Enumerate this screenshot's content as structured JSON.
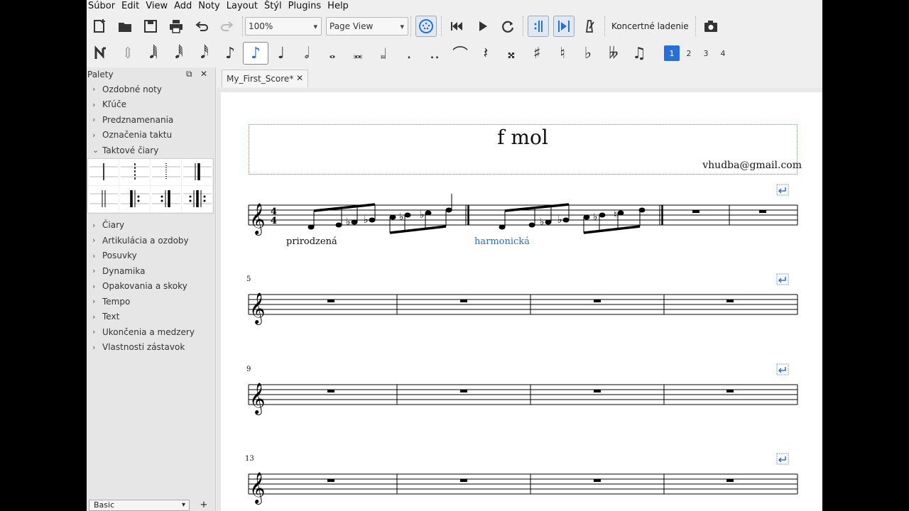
{
  "menu": [
    "Súbor",
    "Edit",
    "View",
    "Add",
    "Noty",
    "Layout",
    "Štýl",
    "Plugins",
    "Help"
  ],
  "toolbar": {
    "zoom_value": "100%",
    "view_mode": "Page View",
    "concert_pitch_label": "Koncertné ladenie"
  },
  "note_input": {
    "durations": [
      "64th",
      "32nd",
      "16th",
      "8th",
      "quarter",
      "half",
      "whole",
      "breve",
      "longa"
    ],
    "active_duration": "8th",
    "voices": [
      "1",
      "2",
      "3",
      "4"
    ],
    "active_voice": "1"
  },
  "palette": {
    "title": "Palety",
    "items_top": [
      "Ozdobné noty",
      "Kľúče",
      "Predznamenania",
      "Označenia taktu",
      "Taktové čiary"
    ],
    "items_bottom": [
      "Čiary",
      "Artikulácia a ozdoby",
      "Posuvky",
      "Dynamika",
      "Opakovania a skoky",
      "Tempo",
      "Text",
      "Ukončenia a medzery",
      "Vlastnosti zástavok"
    ],
    "workspace": "Basic"
  },
  "tab": {
    "label": "My_First_Score*"
  },
  "score": {
    "title": "f mol",
    "composer": "vhudba@gmail.com",
    "time_signature": "4/4",
    "staff_texts": [
      "prirodzená",
      "harmonická"
    ],
    "measure_numbers": [
      "5",
      "9",
      "13"
    ]
  },
  "colors": {
    "accent": "#2a6fd6",
    "staff_text_blue": "#2e6fb5"
  }
}
